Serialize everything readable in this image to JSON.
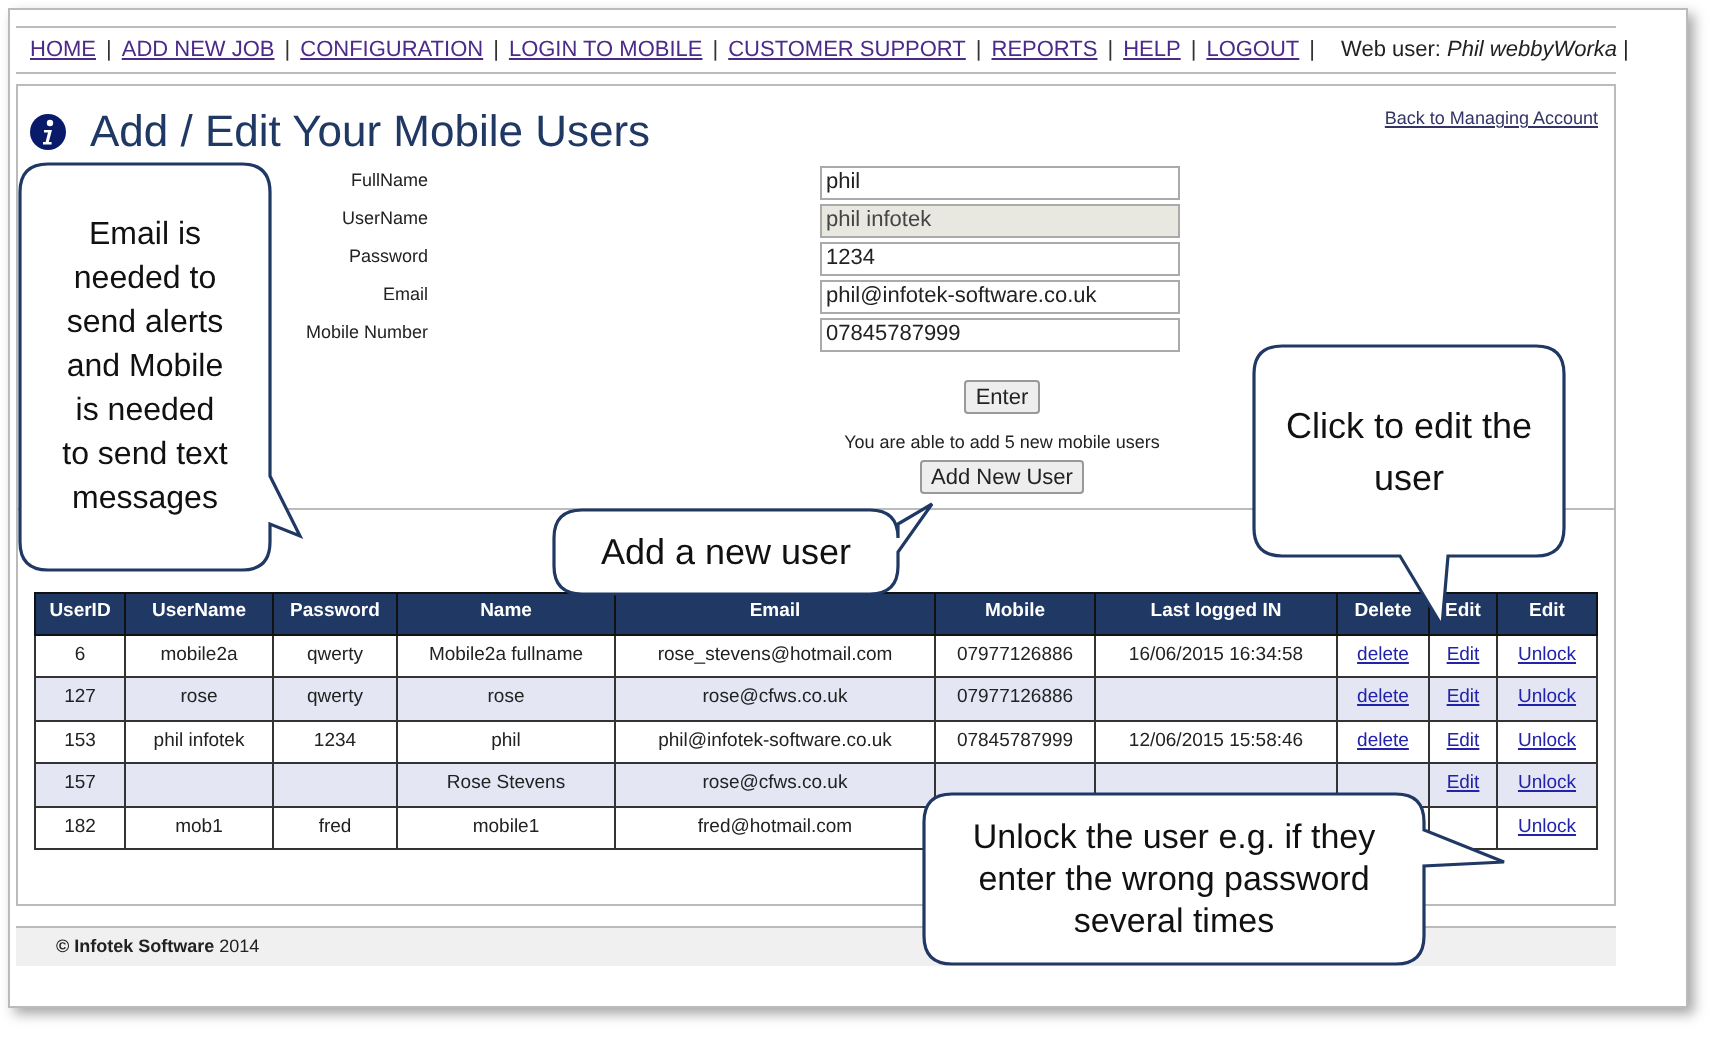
{
  "nav": {
    "items": [
      {
        "label": "HOME",
        "separator": "|"
      },
      {
        "label": "ADD NEW JOB",
        "separator": "|"
      },
      {
        "label": "CONFIGURATION",
        "separator": "|"
      },
      {
        "label": "LOGIN TO MOBILE",
        "separator": "|"
      },
      {
        "label": "CUSTOMER SUPPORT",
        "separator": "|"
      },
      {
        "label": "REPORTS",
        "separator": "|"
      },
      {
        "label": "HELP",
        "separator": "|"
      },
      {
        "label": "LOGOUT",
        "separator": "|"
      }
    ],
    "web_user": "Web user: *Phil webbyWorka* |"
  },
  "page": {
    "title": "Add / Edit Your Mobile Users",
    "back_link": "Back to Managing Account"
  },
  "form": {
    "fields": [
      {
        "label": "FullName",
        "value": "phil",
        "disabled": false
      },
      {
        "label": "UserName",
        "value": "phil infotek",
        "disabled": true
      },
      {
        "label": "Password",
        "value": "1234",
        "disabled": false
      },
      {
        "label": "Email",
        "value": "phil@infotek-software.co.uk",
        "disabled": false
      },
      {
        "label": "Mobile Number",
        "value": "07845787999",
        "disabled": false
      }
    ],
    "enter_button": "Enter",
    "notice": "You are able to add 5 new mobile users",
    "add_button": "Add New User"
  },
  "table": {
    "columns": [
      "UserID",
      "UserName",
      "Password",
      "Name",
      "Email",
      "Mobile",
      "Last logged IN",
      "Delete",
      "Edit",
      "Edit"
    ],
    "rows": [
      {
        "user_id": "6",
        "user_name": "mobile2a",
        "password": "qwerty",
        "name": "Mobile2a fullname",
        "email": "rose_stevens@hotmail.com",
        "mobile": "07977126886",
        "last_logged_in": "16/06/2015 16:34:58",
        "delete": "delete",
        "edit": "Edit",
        "unlock": "Unlock"
      },
      {
        "user_id": "127",
        "user_name": "rose",
        "password": "qwerty",
        "name": "rose",
        "email": "rose@cfws.co.uk",
        "mobile": "07977126886",
        "delete": "delete",
        "edit": "Edit",
        "unlock": "Unlock"
      },
      {
        "user_id": "153",
        "user_name": "phil infotek",
        "password": "1234",
        "name": "phil",
        "email": "phil@infotek-software.co.uk",
        "mobile": "07845787999",
        "last_logged_in": "12/06/2015 15:58:46",
        "delete": "delete",
        "edit": "Edit",
        "unlock": "Unlock"
      },
      {
        "user_id": "157",
        "name": "Rose Stevens",
        "email": "rose@cfws.co.uk",
        "edit": "Edit",
        "unlock": "Unlock"
      },
      {
        "user_id": "182",
        "user_name": "mob1",
        "password": "fred",
        "name": "mobile1",
        "email": "fred@hotmail.com",
        "unlock": "Unlock"
      }
    ]
  },
  "callouts": [
    {
      "text": "Email is needed to send alerts and Mobile is needed to send text messages"
    },
    {
      "text": "Add a new user"
    },
    {
      "text": "Click to edit the user"
    },
    {
      "text": "Unlock the user e.g. if they enter the wrong password several times"
    }
  ],
  "footer": "**© Infotek Software** 2014"
}
